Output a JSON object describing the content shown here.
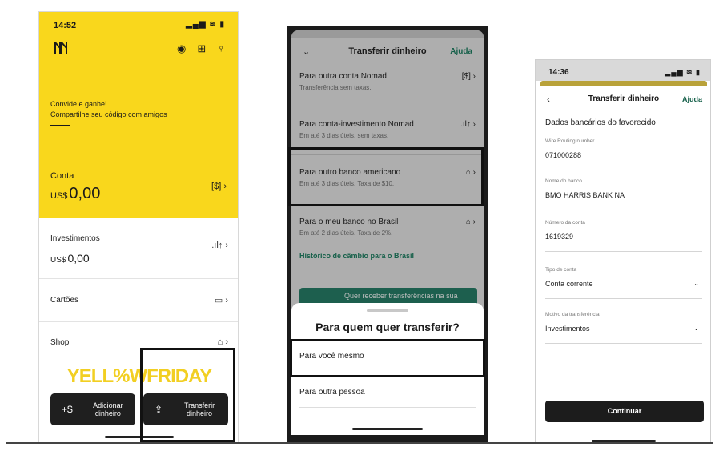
{
  "phone1": {
    "status_time": "14:52",
    "status_icons": "▂▄▆ ≋ ▮",
    "invite_title": "Convide e ganhe!",
    "invite_subtitle": "Compartilhe seu código com amigos",
    "account_label": "Conta",
    "account_currency": "US$",
    "account_amount": "0,00",
    "investments_label": "Investimentos",
    "investments_currency": "US$",
    "investments_amount": "0,00",
    "cards_label": "Cartões",
    "shop_label": "Shop",
    "promo_text": "YELL%WFRIDAY",
    "add_money_label": "Adicionar dinheiro",
    "transfer_money_label": "Transferir dinheiro"
  },
  "phone2": {
    "header_title": "Transferir dinheiro",
    "header_help": "Ajuda",
    "options": [
      {
        "title": "Para outra conta Nomad",
        "subtitle": "Transferência sem taxas."
      },
      {
        "title": "Para conta-investimento Nomad",
        "subtitle": "Em até 3 dias úteis, sem taxas."
      },
      {
        "title": "Para outro banco americano",
        "subtitle": "Em até 3 dias úteis. Taxa de $10."
      },
      {
        "title": "Para o meu banco no Brasil",
        "subtitle": "Em até 2 dias úteis. Taxa de 2%."
      }
    ],
    "history_link": "Histórico de câmbio para o Brasil",
    "banner_text": "Quer receber transferências na sua",
    "sheet_title": "Para quem quer transferir?",
    "sheet_option_self": "Para você mesmo",
    "sheet_option_other": "Para outra pessoa"
  },
  "phone3": {
    "status_time": "14:36",
    "status_icons": "▂▄▆ ≋ ▮",
    "title": "Transferir dinheiro",
    "help": "Ajuda",
    "section_title": "Dados bancários do favorecido",
    "fields": [
      {
        "label": "Wire Routing number",
        "value": "071000288"
      },
      {
        "label": "Nome do banco",
        "value": "BMO HARRIS BANK NA"
      },
      {
        "label": "Número da conta",
        "value": "1619329"
      },
      {
        "label": "Tipo de conta",
        "value": "Conta corrente"
      },
      {
        "label": "Motivo da transferência",
        "value": "Investimentos"
      }
    ],
    "continue_label": "Continuar"
  },
  "colors": {
    "brand_yellow": "#f9d71c",
    "link_green": "#16604a",
    "button_dark": "#1f1f1f"
  },
  "icons": [
    "logo-icon",
    "eye-icon",
    "gift-icon",
    "user-icon",
    "dollar-icon",
    "chart-icon",
    "card-icon",
    "bag-icon",
    "add-money-icon",
    "transfer-icon",
    "chevron-down-icon",
    "bank-icon",
    "home-icon",
    "back-arrow-icon"
  ]
}
